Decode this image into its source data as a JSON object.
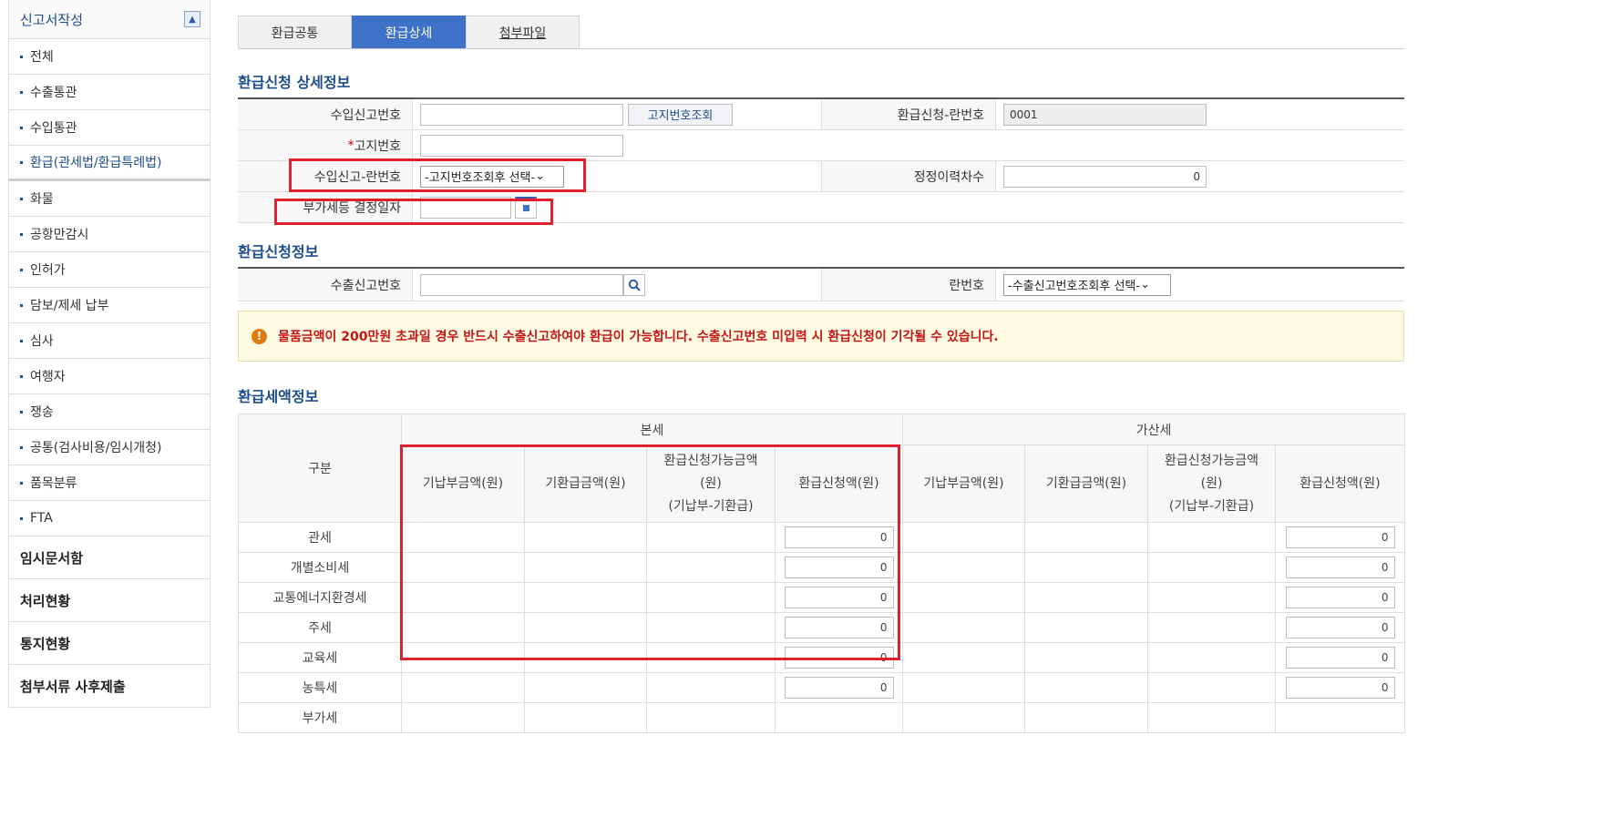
{
  "sidebar": {
    "header": "신고서작성",
    "collapse_icon": "▲",
    "items": [
      {
        "label": "전체"
      },
      {
        "label": "수출통관"
      },
      {
        "label": "수입통관"
      },
      {
        "label": "환급(관세법/환급특례법)"
      },
      {
        "label": "화물"
      },
      {
        "label": "공항만감시"
      },
      {
        "label": "인허가"
      },
      {
        "label": "담보/제세 납부"
      },
      {
        "label": "심사"
      },
      {
        "label": "여행자"
      },
      {
        "label": "쟁송"
      },
      {
        "label": "공통(검사비용/임시개청)"
      },
      {
        "label": "품목분류"
      },
      {
        "label": "FTA"
      }
    ],
    "top_items": [
      {
        "label": "임시문서함"
      },
      {
        "label": "처리현황"
      },
      {
        "label": "통지현황"
      },
      {
        "label": "첨부서류 사후제출"
      }
    ]
  },
  "tabs": [
    {
      "label": "환급공통"
    },
    {
      "label": "환급상세"
    },
    {
      "label": "첨부파일"
    }
  ],
  "detail": {
    "title": "환급신청 상세정보",
    "import_decl_no_label": "수입신고번호",
    "import_decl_no_value": "",
    "notice_lookup_button": "고지번호조회",
    "refund_line_no_label": "환급신청-란번호",
    "refund_line_no_value": "0001",
    "notice_no_required": "*",
    "notice_no_label": "고지번호",
    "notice_no_value": "",
    "import_line_label": "수입신고-란번호",
    "import_line_select": "-고지번호조회후 선택-",
    "revision_count_label": "정정이력차수",
    "revision_count_value": "0",
    "vat_date_label": "부가세등 결정일자",
    "vat_date_value": ""
  },
  "refund_request": {
    "title": "환급신청정보",
    "export_decl_no_label": "수출신고번호",
    "export_decl_no_value": "",
    "line_no_label": "란번호",
    "line_no_select": "-수출신고번호조회후 선택-"
  },
  "notice": {
    "icon": "!",
    "text": "물품금액이 200만원 초과일 경우 반드시 수출신고하여야 환급이 가능합니다. 수출신고번호 미입력 시 환급신청이 기각될 수 있습니다."
  },
  "amount": {
    "title": "환급세액정보",
    "col_category": "구분",
    "group_main": "본세",
    "group_add": "가산세",
    "col_paid": "기납부금액(원)",
    "col_refunded": "기환급금액(원)",
    "col_available_1": "환급신청가능금액",
    "col_available_2": "(원)",
    "col_available_3": "(기납부-기환급)",
    "col_request": "환급신청액(원)",
    "rows": [
      {
        "label": "관세",
        "main_req": "0",
        "add_req": "0"
      },
      {
        "label": "개별소비세",
        "main_req": "0",
        "add_req": "0"
      },
      {
        "label": "교통에너지환경세",
        "main_req": "0",
        "add_req": "0"
      },
      {
        "label": "주세",
        "main_req": "0",
        "add_req": "0"
      },
      {
        "label": "교육세",
        "main_req": "0",
        "add_req": "0"
      },
      {
        "label": "농특세",
        "main_req": "0",
        "add_req": "0"
      },
      {
        "label": "부가세",
        "main_req": "",
        "add_req": ""
      }
    ]
  },
  "colors": {
    "accent": "#3e72c8",
    "title": "#1e4d8c",
    "highlight": "#e0202d",
    "warning": "#c41616"
  }
}
